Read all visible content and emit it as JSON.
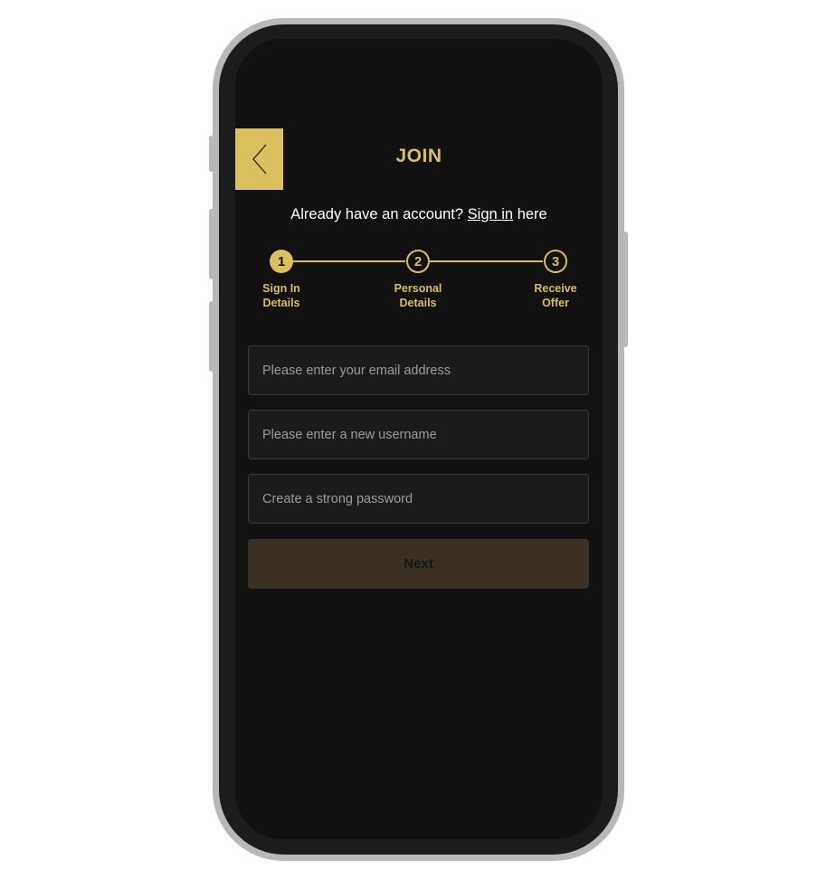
{
  "header": {
    "title": "JOIN",
    "back_icon": "chevron-left-icon"
  },
  "signin_prompt": {
    "prefix": "Already have an account?",
    "link_label": "Sign in",
    "suffix": "here"
  },
  "stepper": {
    "active_step": 1,
    "steps": [
      {
        "number": "1",
        "label_line1": "Sign In",
        "label_line2": "Details"
      },
      {
        "number": "2",
        "label_line1": "Personal",
        "label_line2": "Details"
      },
      {
        "number": "3",
        "label_line1": "Receive",
        "label_line2": "Offer"
      }
    ]
  },
  "form": {
    "email_placeholder": "Please enter your email address",
    "username_placeholder": "Please enter a new username",
    "password_placeholder": "Create a strong password",
    "next_label": "Next"
  },
  "colors": {
    "accent": "#dcbf5f",
    "background": "#111111",
    "field_background": "#1b1b1b",
    "button_disabled": "#3a3124"
  }
}
